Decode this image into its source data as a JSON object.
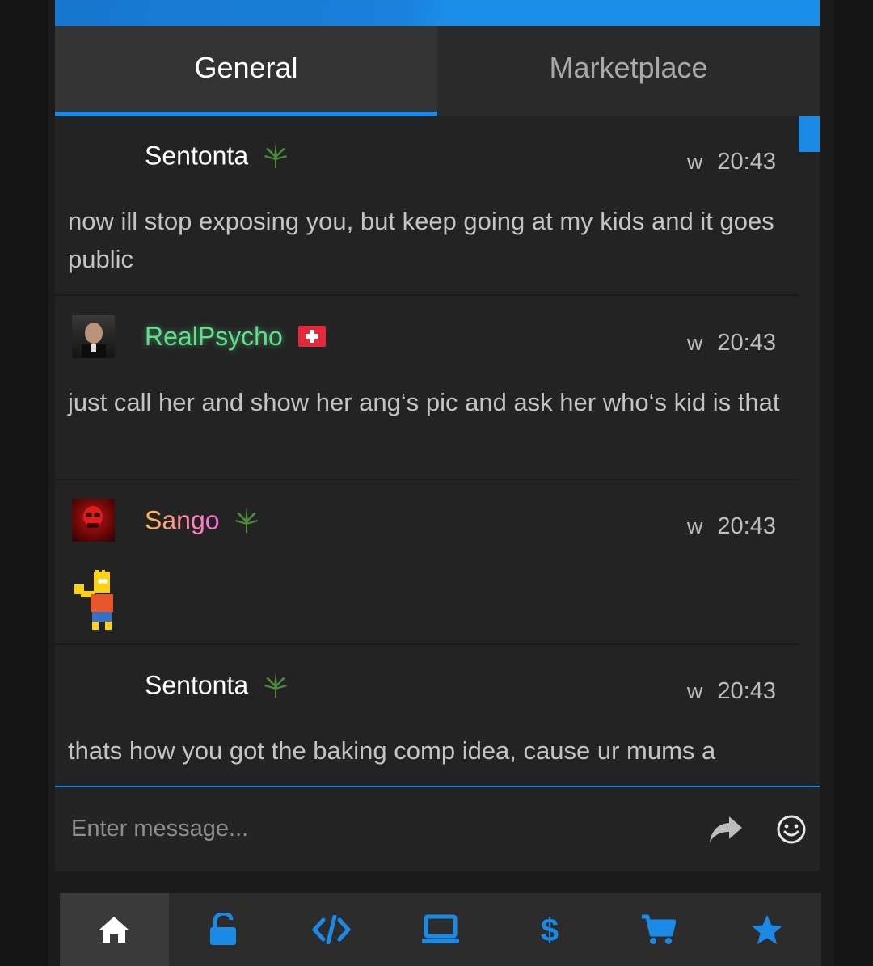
{
  "tabs": [
    {
      "label": "General",
      "active": true
    },
    {
      "label": "Marketplace",
      "active": false
    }
  ],
  "messages": [
    {
      "username": "Sentonta",
      "name_color": "#ffffff",
      "badge": "leaf-icon",
      "w": "w",
      "time": "20:43",
      "text": "now ill stop exposing you, but keep going at my kids and it goes public"
    },
    {
      "username": "RealPsycho",
      "name_color": "#5fe08a",
      "badge": "swiss-flag-icon",
      "w": "w",
      "time": "20:43",
      "text": "just call her and show her ang‘s pic and ask her who‘s kid is that"
    },
    {
      "username": "Sango",
      "name_color": "#e3a6c4",
      "badge": "leaf-icon",
      "w": "w",
      "time": "20:43",
      "text": "",
      "sticker": "bart-waving-sticker"
    },
    {
      "username": "Sentonta",
      "name_color": "#ffffff",
      "badge": "leaf-icon",
      "w": "w",
      "time": "20:43",
      "text": "thats how you got the baking comp idea, cause ur mums a"
    }
  ],
  "composer": {
    "placeholder": "Enter message..."
  },
  "nav": [
    "home-icon",
    "unlock-icon",
    "code-icon",
    "laptop-icon",
    "dollar-icon",
    "cart-icon",
    "star-icon"
  ],
  "colors": {
    "accent": "#1a8ae6",
    "panel": "#232323",
    "tab_bar": "#2a2a2a"
  }
}
